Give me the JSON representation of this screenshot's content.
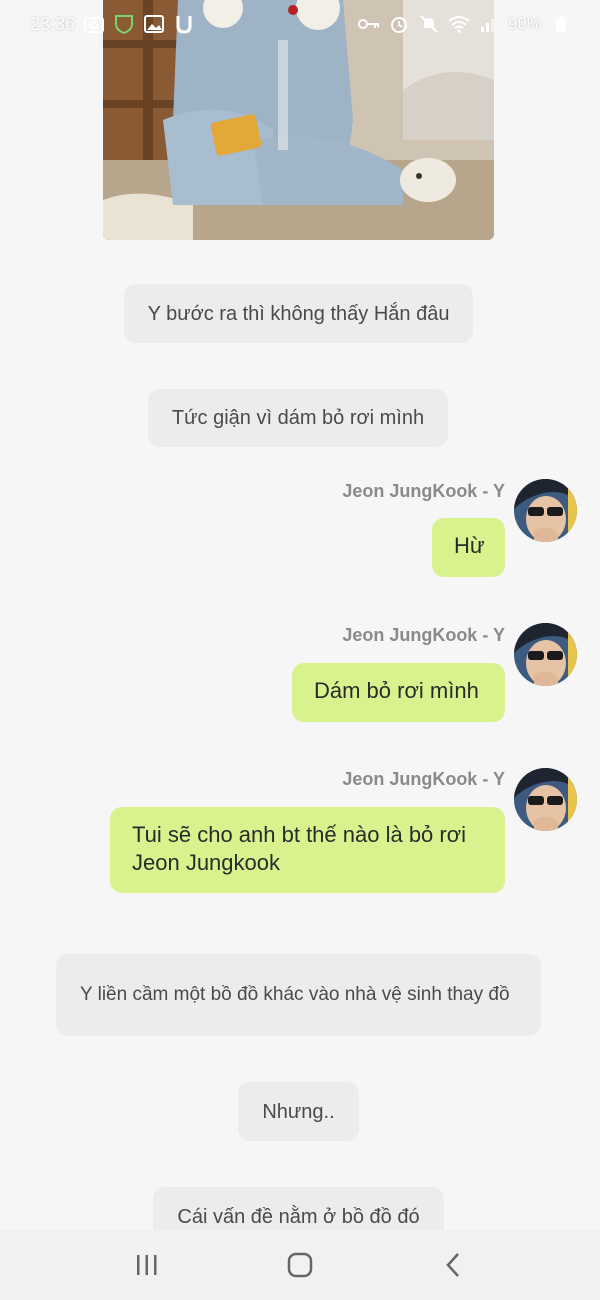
{
  "status_bar": {
    "time": "23:36",
    "battery": "90%",
    "icons_left": [
      "camera-icon",
      "vpn-shield-icon",
      "gallery-icon",
      "u-app-icon"
    ],
    "icons_right": [
      "key-icon",
      "alarm-icon",
      "mute-icon",
      "wifi-icon",
      "signal-icon",
      "battery-icon"
    ]
  },
  "messages": {
    "narration_1": "Y bước ra thì không thấy Hắn đâu",
    "narration_2": "Tức giận vì dám bỏ rơi mình",
    "jk_1": {
      "sender": "Jeon JungKook - Y",
      "text": "Hừ"
    },
    "jk_2": {
      "sender": "Jeon JungKook - Y",
      "text": "Dám bỏ rơi mình"
    },
    "jk_3": {
      "sender": "Jeon JungKook - Y",
      "text": "Tui sẽ cho anh bt thế nào là bỏ rơi Jeon Jungkook"
    },
    "narration_3": "Y liền cầm một bồ đồ khác vào nhà vệ sinh thay đồ",
    "narration_4": "Nhưng..",
    "narration_5": "Cái vấn đề nằm ở bồ đồ đó"
  },
  "nav": {
    "icons": [
      "recent-apps-icon",
      "home-icon",
      "back-icon"
    ]
  },
  "colors": {
    "background": "#f6f6f6",
    "narration_bubble": "#ececec",
    "character_bubble": "#d8f38e",
    "sender_name": "#8a8a8a"
  }
}
